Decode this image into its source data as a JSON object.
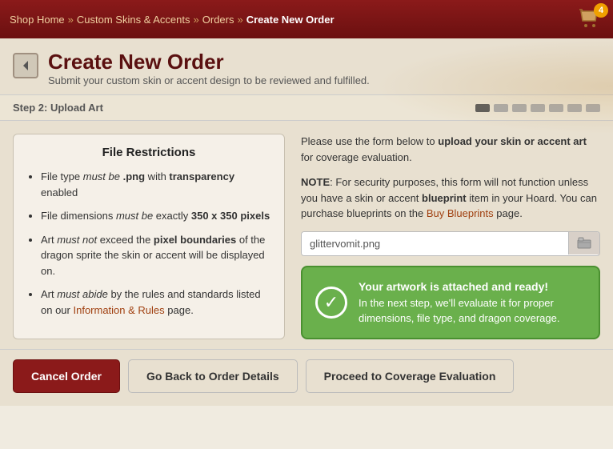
{
  "breadcrumb": {
    "shop_home": "Shop Home",
    "sep1": "»",
    "custom_skins": "Custom Skins & Accents",
    "sep2": "»",
    "orders": "Orders",
    "sep3": "»",
    "current": "Create New Order"
  },
  "cart": {
    "count": "4"
  },
  "page": {
    "title": "Create New Order",
    "subtitle": "Submit your custom skin or accent design to be reviewed and fulfilled."
  },
  "step": {
    "label": "Step 2: Upload Art",
    "dots": [
      true,
      false,
      false,
      false,
      false,
      false,
      false
    ]
  },
  "restrictions": {
    "heading": "File Restrictions",
    "items": [
      "File type must be .png with transparency enabled",
      "File dimensions must be exactly 350 x 350 pixels",
      "Art must not exceed the pixel boundaries of the dragon sprite the skin or accent will be displayed on.",
      "Art must abide by the rules and standards listed on our Information & Rules page."
    ],
    "info_link": "Information & Rules"
  },
  "upload": {
    "instructions_plain": "Please use the form below to ",
    "instructions_bold": "upload your skin or accent art",
    "instructions_end": " for coverage evaluation.",
    "note_label": "NOTE",
    "note_text": ": For security purposes, this form will not function unless you have a skin or accent ",
    "blueprint": "blueprint",
    "note_text2": " item in your Hoard. You can purchase blueprints on the ",
    "buy_blueprints": "Buy Blueprints",
    "note_end": " page.",
    "file_placeholder": "glittervomit.png",
    "success_title": "Your artwork is attached and ready!",
    "success_body": "In the next step, we'll evaluate it for proper dimensions, file type, and dragon coverage."
  },
  "buttons": {
    "cancel": "Cancel Order",
    "back": "Go Back to Order Details",
    "proceed": "Proceed to Coverage Evaluation"
  }
}
